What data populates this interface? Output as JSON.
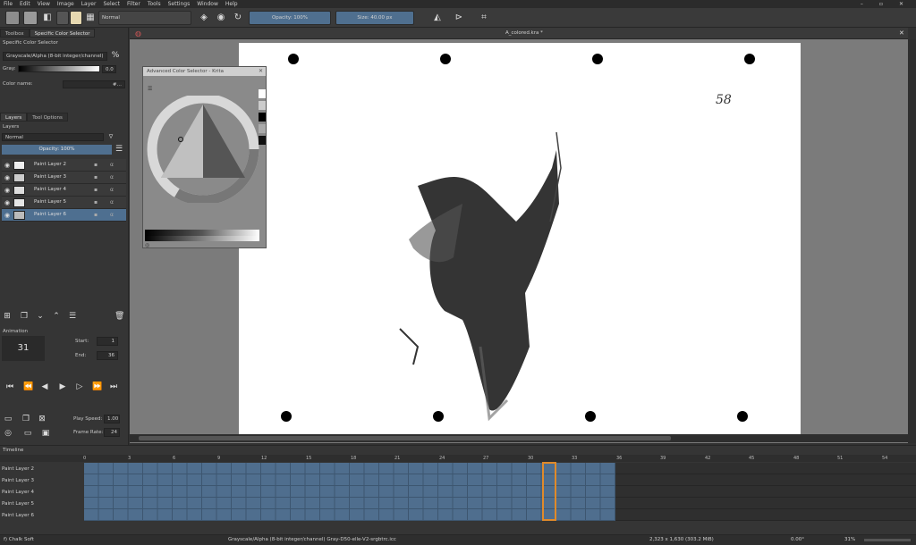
{
  "menu": [
    "File",
    "Edit",
    "View",
    "Image",
    "Layer",
    "Select",
    "Filter",
    "Tools",
    "Settings",
    "Window",
    "Help"
  ],
  "toolbar": {
    "blend_mode": "Normal",
    "opacity": "Opacity: 100%",
    "size": "Size: 40.00 px"
  },
  "left_panel": {
    "tabs": [
      "Toolbox",
      "Specific Color Selector"
    ],
    "selector_title": "Specific Color Selector",
    "color_model": "Grayscale/Alpha (8-bit integer/channel)",
    "gray_label": "Gray:",
    "gray_value": "0.0",
    "color_name_label": "Color name:",
    "color_name_value": "#…",
    "layer_tabs": [
      "Layers",
      "Tool Options"
    ],
    "layers_title": "Layers",
    "layer_blend": "Normal",
    "layer_opacity": "Opacity: 100%",
    "layers": [
      "Paint Layer 2",
      "Paint Layer 3",
      "Paint Layer 4",
      "Paint Layer 5",
      "Paint Layer 6"
    ],
    "animation_title": "Animation",
    "current_frame": "31",
    "start_label": "Start:",
    "start_value": "1",
    "end_label": "End:",
    "end_value": "36",
    "play_speed_label": "Play Speed:",
    "play_speed_value": "1.00",
    "frame_rate_label": "Frame Rate:",
    "frame_rate_value": "24"
  },
  "canvas": {
    "doc_title": "A_colored.kra *",
    "page_number": "58"
  },
  "acs": {
    "title": "Advanced Color Selector - Krita"
  },
  "timeline": {
    "title": "Timeline",
    "rows": [
      "Paint Layer 2",
      "Paint Layer 3",
      "Paint Layer 4",
      "Paint Layer 5",
      "Paint Layer 6"
    ],
    "ruler": [
      "0",
      "3",
      "6",
      "9",
      "12",
      "15",
      "18",
      "21",
      "24",
      "27",
      "30",
      "33",
      "36",
      "39",
      "42",
      "45",
      "48",
      "51",
      "54"
    ]
  },
  "status": {
    "brush": "f) Chalk Soft",
    "colorspace": "Grayscale/Alpha (8-bit integer/channel)  Gray-D50-elle-V2-srgbtrc.icc",
    "dimensions": "2,323 x 1,630 (303.2 MiB)",
    "rotation": "0.00°",
    "zoom": "31%"
  },
  "colors": {
    "accent": "#4e6f90",
    "frame_highlight": "#e08a2a",
    "cells": "#4f6e8e"
  },
  "icons": [
    "eraser-icon",
    "brush-icon",
    "mirror-icon",
    "close-icon",
    "play-icon",
    "eye-icon",
    "gear-icon"
  ]
}
